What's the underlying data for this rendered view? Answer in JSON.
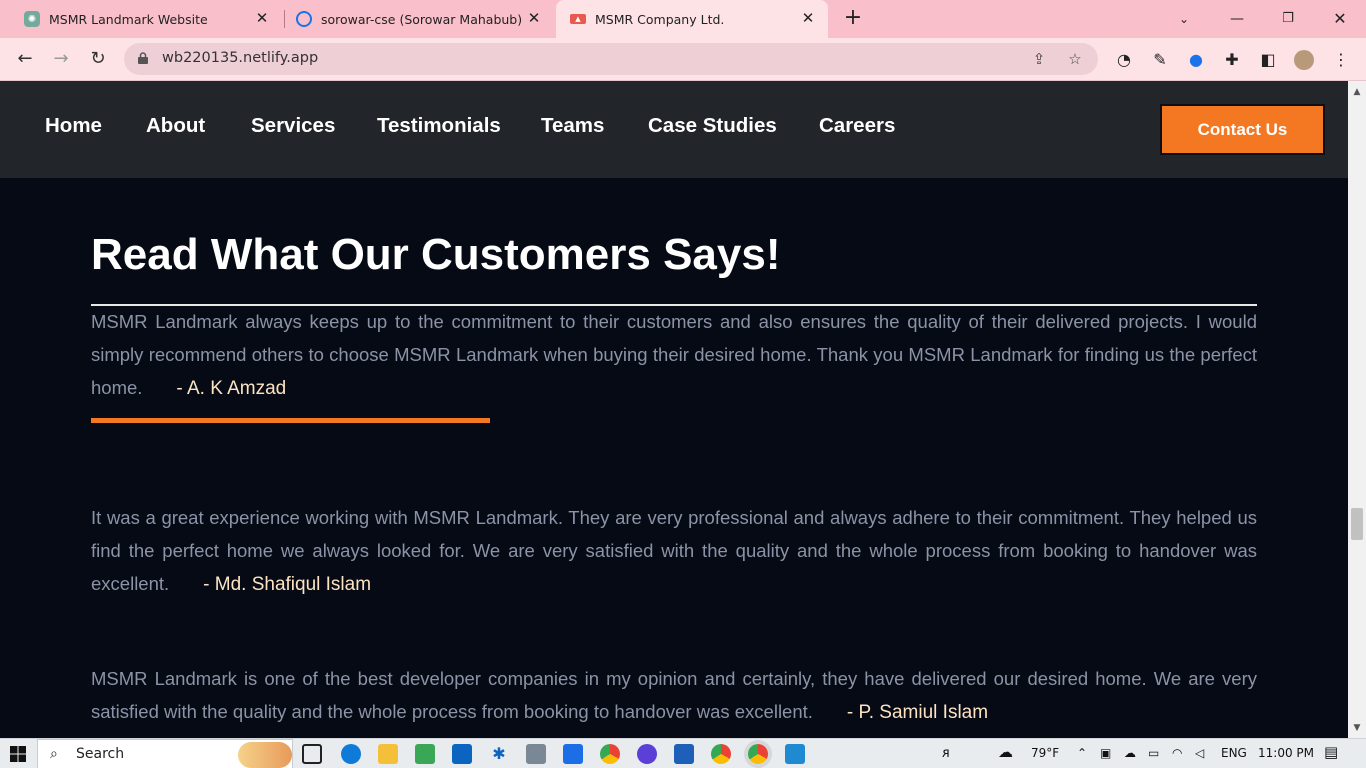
{
  "browser": {
    "tabs": [
      {
        "title": "MSMR Landmark Website",
        "icon": "chatgpt-icon",
        "color": "#74aa9c"
      },
      {
        "title": "sorowar-cse (Sorowar Mahabub)",
        "icon": "chrome-search-icon",
        "color": "#1a73e8"
      },
      {
        "title": "MSMR Company Ltd.",
        "icon": "msmr-favicon",
        "color": "#e85a4f"
      }
    ],
    "url": "wb220135.netlify.app",
    "accent": "#f9c0cb"
  },
  "site": {
    "nav": [
      "Home",
      "About",
      "Services",
      "Testimonials",
      "Teams",
      "Case Studies",
      "Careers"
    ],
    "contact_label": "Contact Us",
    "accent_color": "#f47822",
    "heading": "Read What Our Customers Says!",
    "testimonials": [
      {
        "text": "MSMR Landmark always keeps up to the commitment to their customers and also ensures the quality of their delivered projects. I would simply recommend others to choose MSMR Landmark when buying their desired home. Thank you MSMR Landmark for finding us the perfect home.",
        "author": "- A. K Amzad"
      },
      {
        "text": "It was a great experience working with MSMR Landmark. They are very professional and always adhere to their commitment. They helped us find the perfect home we always looked for. We are very satisfied with the quality and the whole process from booking to handover was excellent.",
        "author": "- Md. Shafiqul Islam"
      },
      {
        "text": "MSMR Landmark is one of the best developer companies in my opinion and certainly, they have delivered our desired home. We are very satisfied with the quality and the whole process from booking to handover was excellent.",
        "author": "- P. Samiul Islam"
      }
    ]
  },
  "taskbar": {
    "search_label": "Search",
    "weather": "79°F",
    "language": "ENG",
    "time": "11:00 PM"
  }
}
